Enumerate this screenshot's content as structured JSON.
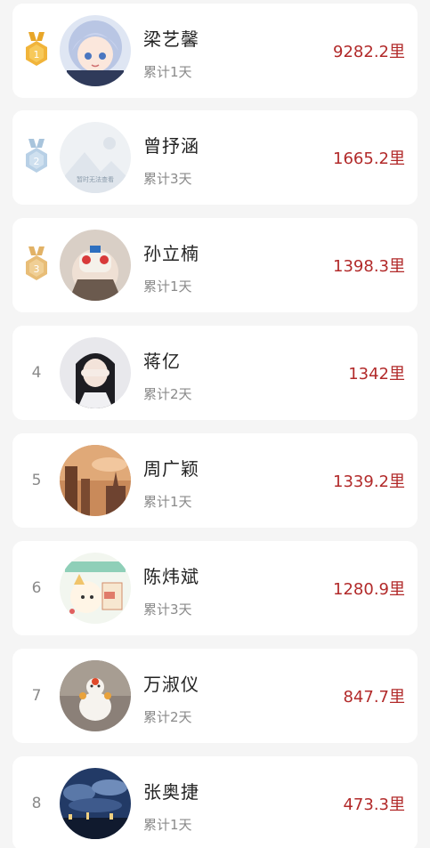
{
  "leaderboard": {
    "entries": [
      {
        "rank": "1",
        "name": "梁艺馨",
        "days": "累计1天",
        "distance": "9282.2里",
        "medal": "gold",
        "avatar": "anime-girl-avatar"
      },
      {
        "rank": "2",
        "name": "曾抒涵",
        "days": "累计3天",
        "distance": "1665.2里",
        "medal": "silver",
        "avatar": "placeholder-avatar",
        "avatar_caption": "暂时无法查看"
      },
      {
        "rank": "3",
        "name": "孙立楠",
        "days": "累计1天",
        "distance": "1398.3里",
        "medal": "bronze",
        "avatar": "masked-face-avatar"
      },
      {
        "rank": "4",
        "name": "蒋亿",
        "days": "累计2天",
        "distance": "1342里",
        "medal": "",
        "avatar": "girl-hands-avatar"
      },
      {
        "rank": "5",
        "name": "周广颖",
        "days": "累计1天",
        "distance": "1339.2里",
        "medal": "",
        "avatar": "sunset-city-avatar"
      },
      {
        "rank": "6",
        "name": "陈炜斌",
        "days": "累计3天",
        "distance": "1280.9里",
        "medal": "",
        "avatar": "cartoon-sticker-avatar"
      },
      {
        "rank": "7",
        "name": "万淑仪",
        "days": "累计2天",
        "distance": "847.7里",
        "medal": "",
        "avatar": "cake-figure-avatar"
      },
      {
        "rank": "8",
        "name": "张奥捷",
        "days": "累计1天",
        "distance": "473.3里",
        "medal": "",
        "avatar": "night-sky-avatar"
      }
    ]
  },
  "colors": {
    "background": "#f5f5f5",
    "card": "#ffffff",
    "distance": "#b22a2a",
    "name": "#222222",
    "secondary": "#8a8a8a",
    "gold": "#e8a628",
    "silver": "#a8c4dc",
    "bronze": "#e2b266"
  }
}
